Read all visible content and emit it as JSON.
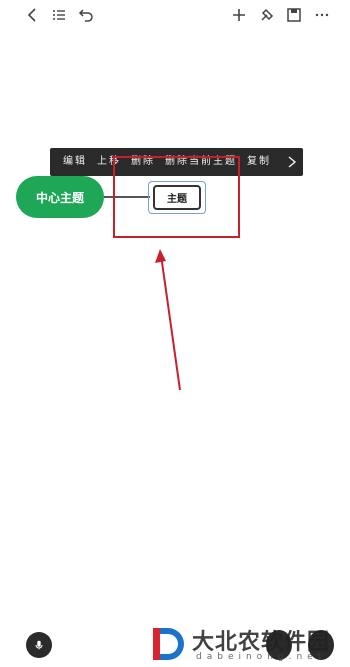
{
  "toolbar": {
    "icons": [
      "back-icon",
      "outline-icon",
      "undo-icon",
      "add-icon",
      "format-icon",
      "save-icon",
      "more-icon"
    ]
  },
  "context_menu": {
    "items": [
      "编辑",
      "上移",
      "删除",
      "删除当前主题",
      "复制"
    ],
    "more_icon": "chevron-right-icon"
  },
  "mindmap": {
    "central_topic": "中心主题",
    "subtopic": "主题",
    "central_color": "#1ea757"
  },
  "annotation": {
    "highlight_color": "#c8202a"
  },
  "watermark": {
    "title": "大北农软件园",
    "subtitle": "dabeinong.net"
  }
}
